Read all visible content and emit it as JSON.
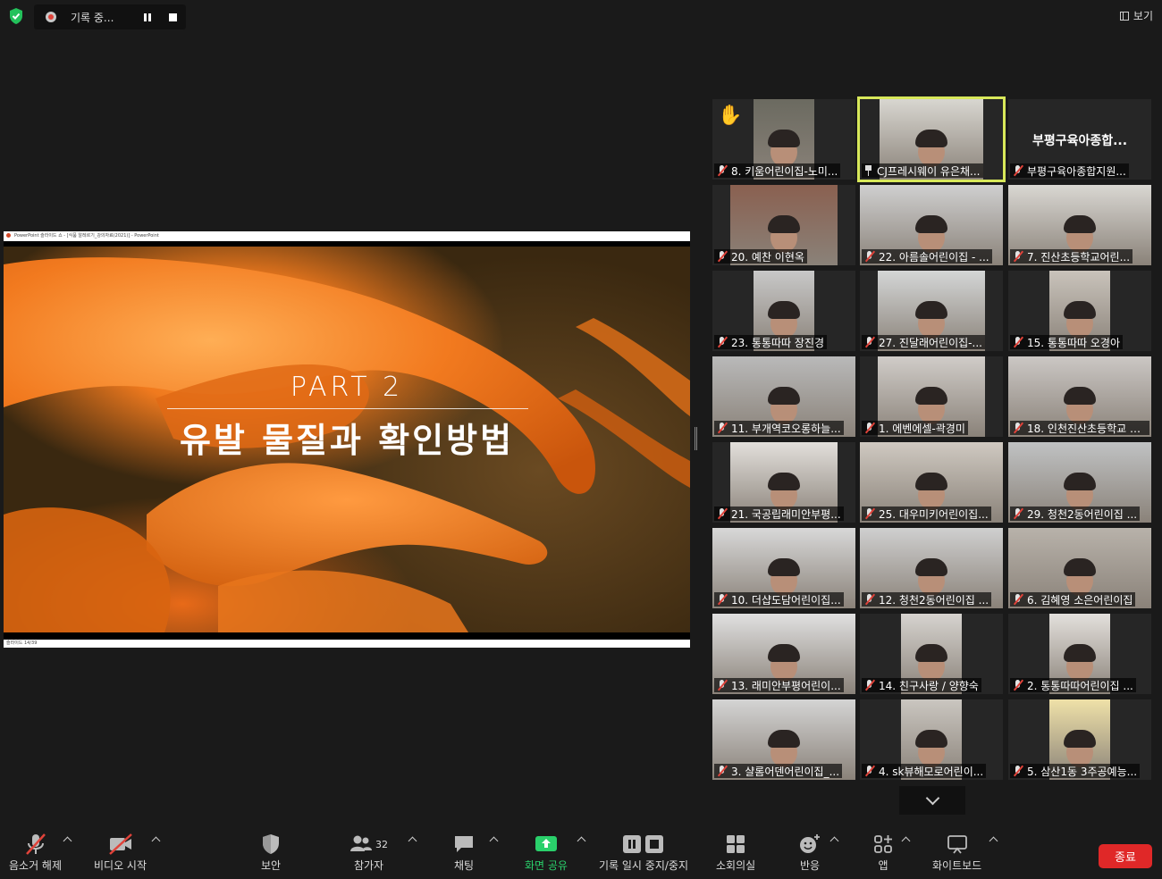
{
  "topbar": {
    "recording_label": "기록 중...",
    "view_label": "보기"
  },
  "share": {
    "window_title": "PowerPoint 슬라이드 쇼 - [식품 알레르기_강의자료(2021)] - PowerPoint",
    "status_text": "슬라이드 14/39",
    "slide": {
      "part_label": "PART 2",
      "title": "유발 물질과 확인방법"
    }
  },
  "participants": [
    {
      "name": "8. 키움어린이집-노미...",
      "muted": true,
      "hand": true
    },
    {
      "name": "CJ프레시웨이 유은채...",
      "pinned": true,
      "active": true
    },
    {
      "name": "부평구육아종합지원...",
      "muted": true,
      "display_name": "부평구육아종합..."
    },
    {
      "name": "20. 예찬 이현옥",
      "muted": true
    },
    {
      "name": "22. 아름솔어린이집 - ...",
      "muted": true
    },
    {
      "name": "7. 진산초등학교어린...",
      "muted": true
    },
    {
      "name": "23. 통통따따 장진경",
      "muted": true
    },
    {
      "name": "27. 진달래어린이집-...",
      "muted": true
    },
    {
      "name": "15. 통통따따 오경아",
      "muted": true
    },
    {
      "name": "11. 부개역코오롱하늘...",
      "muted": true
    },
    {
      "name": "1. 에벤에셀-곽경미",
      "muted": true
    },
    {
      "name": "18. 인천진산초등학교 어...",
      "muted": true
    },
    {
      "name": "21. 국공립래미안부평...",
      "muted": true
    },
    {
      "name": "25. 대우미키어린이집...",
      "muted": true
    },
    {
      "name": "29. 청천2동어린이집 ...",
      "muted": true
    },
    {
      "name": "10. 더샵도담어린이집...",
      "muted": true
    },
    {
      "name": "12. 청천2동어린이집 ...",
      "muted": true
    },
    {
      "name": "6. 김혜영 소은어린이집",
      "muted": true
    },
    {
      "name": "13. 래미안부평어린이...",
      "muted": true
    },
    {
      "name": "14. 친구사랑 / 양향숙",
      "muted": true
    },
    {
      "name": "2. 통통따따어린이집 ...",
      "muted": true
    },
    {
      "name": "3. 샬롬어덴어린이집_...",
      "muted": true
    },
    {
      "name": "4. sk뷰해모로어린이...",
      "muted": true
    },
    {
      "name": "5. 삼산1동 3주공예능...",
      "muted": true
    }
  ],
  "toolbar": {
    "unmute": "음소거 해제",
    "start_video": "비디오 시작",
    "security": "보안",
    "participants": "참가자",
    "participants_count": "32",
    "chat": "채팅",
    "share_screen": "화면 공유",
    "pause_stop_recording": "기록 일시 중지/중지",
    "breakout_rooms": "소회의실",
    "reactions": "반응",
    "apps": "앱",
    "whiteboard": "화이트보드",
    "end": "종료"
  },
  "colors": {
    "background": "#1a1a1a",
    "active_speaker_border": "#d8e85a",
    "share_green": "#2ad06b",
    "end_red": "#e02828",
    "mute_red": "#e0433a"
  }
}
